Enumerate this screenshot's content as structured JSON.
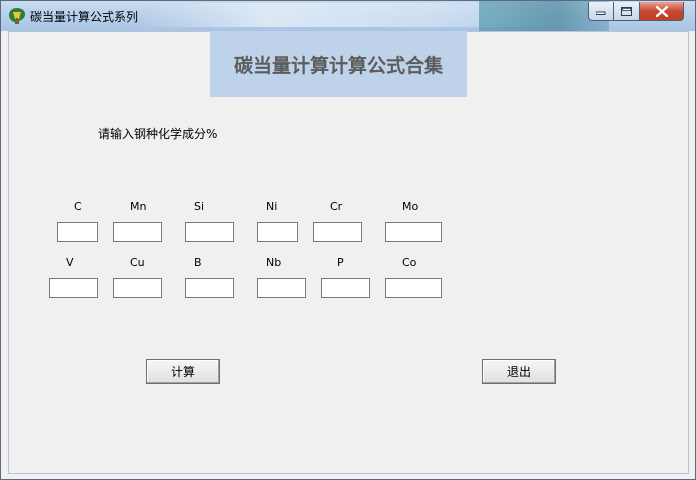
{
  "window": {
    "title": "碳当量计算公式系列",
    "controls": {
      "minimize": "minimize",
      "maximize": "maximize",
      "close": "close"
    }
  },
  "banner": {
    "text": "碳当量计算计算公式合集"
  },
  "prompt": "请输入钢种化学成分%",
  "elements": [
    {
      "label": "C",
      "value": ""
    },
    {
      "label": "Mn",
      "value": ""
    },
    {
      "label": "Si",
      "value": ""
    },
    {
      "label": "Ni",
      "value": ""
    },
    {
      "label": "Cr",
      "value": ""
    },
    {
      "label": "Mo",
      "value": ""
    },
    {
      "label": "V",
      "value": ""
    },
    {
      "label": "Cu",
      "value": ""
    },
    {
      "label": "B",
      "value": ""
    },
    {
      "label": "Nb",
      "value": ""
    },
    {
      "label": "P",
      "value": ""
    },
    {
      "label": "Co",
      "value": ""
    }
  ],
  "buttons": {
    "calculate": "计算",
    "exit": "退出"
  }
}
